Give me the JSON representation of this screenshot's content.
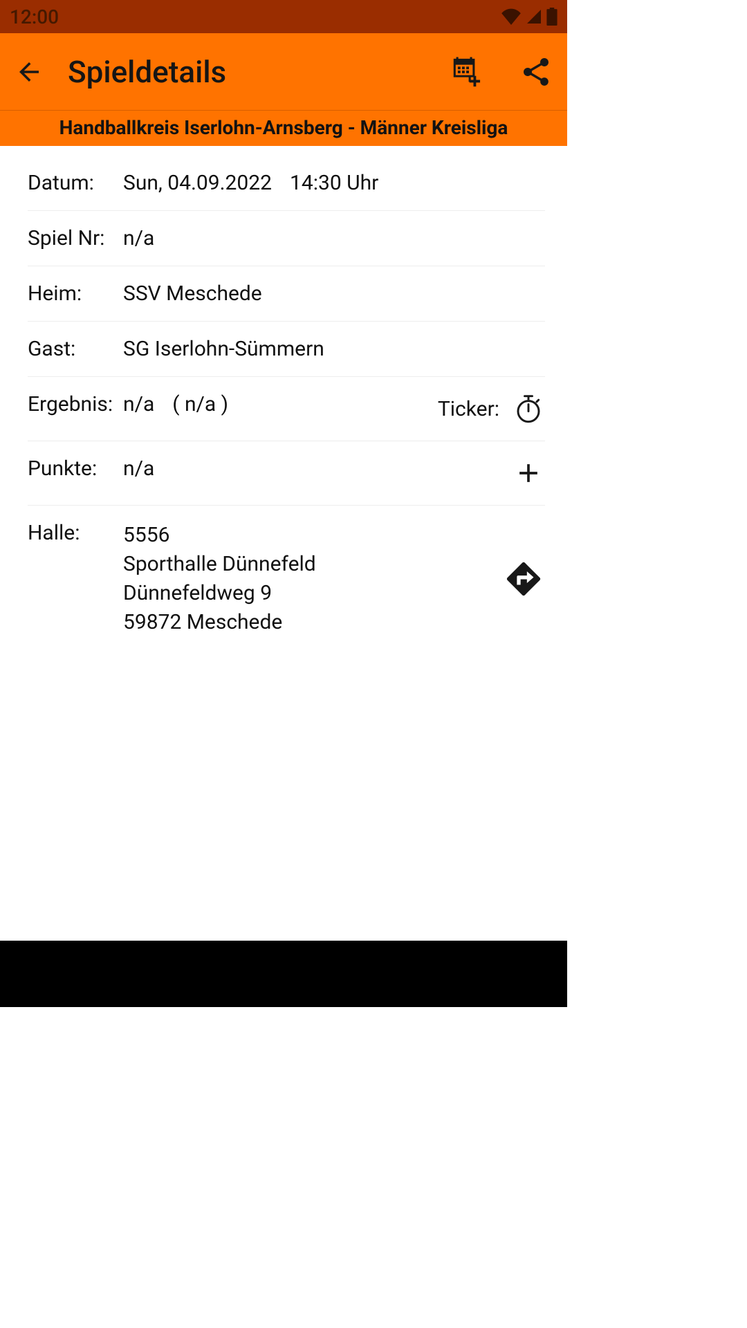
{
  "status": {
    "time": "12:00"
  },
  "appbar": {
    "title": "Spieldetails"
  },
  "league": {
    "title": "Handballkreis Iserlohn-Arnsberg - Männer Kreisliga"
  },
  "rows": {
    "datum": {
      "label": "Datum:",
      "date": "Sun, 04.09.2022",
      "time": "14:30 Uhr"
    },
    "spielnr": {
      "label": "Spiel Nr:",
      "value": "n/a"
    },
    "heim": {
      "label": "Heim:",
      "value": "SSV Meschede"
    },
    "gast": {
      "label": "Gast:",
      "value": "SG Iserlohn-Sümmern"
    },
    "ergebnis": {
      "label": "Ergebnis:",
      "score": "n/a",
      "half": "(  n/a  )",
      "ticker_label": "Ticker:"
    },
    "punkte": {
      "label": "Punkte:",
      "value": "n/a"
    },
    "halle": {
      "label": "Halle:",
      "id": "5556",
      "name": "Sporthalle Dünnefeld",
      "street": "Dünnefeldweg 9",
      "city": "59872 Meschede"
    }
  }
}
